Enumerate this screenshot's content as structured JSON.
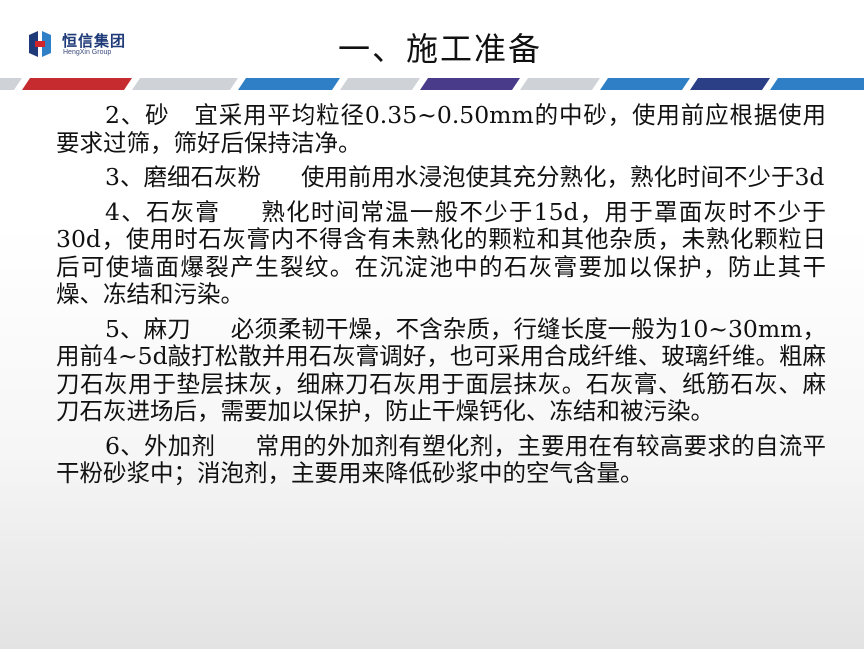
{
  "logo": {
    "name_cn": "恒信集团",
    "name_en": "HengXin Group",
    "icon": "hengxin-logo-icon"
  },
  "title": "一、施工准备",
  "paragraphs": [
    {
      "head": "2、砂",
      "body": "宜采用平均粒径0.35~0.50mm的中砂，使用前应根据使用要求过筛，筛好后保持洁净。"
    },
    {
      "head": "3、磨细石灰粉",
      "body": "使用前用水浸泡使其充分熟化，熟化时间不少于3d"
    },
    {
      "head": "4、石灰膏",
      "body": "熟化时间常温一般不少于15d，用于罩面灰时不少于30d，使用时石灰膏内不得含有未熟化的颗粒和其他杂质，未熟化颗粒日后可使墙面爆裂产生裂纹。在沉淀池中的石灰膏要加以保护，防止其干燥、冻结和污染。"
    },
    {
      "head": "5、麻刀",
      "body": "必须柔韧干燥，不含杂质，行缝长度一般为10~30mm，用前4~5d敲打松散并用石灰膏调好，也可采用合成纤维、玻璃纤维。粗麻刀石灰用于垫层抹灰，细麻刀石灰用于面层抹灰。石灰膏、纸筋石灰、麻刀石灰进场后，需要加以保护，防止干燥钙化、冻结和被污染。"
    },
    {
      "head": "6、外加剂",
      "body": "常用的外加剂有塑化剂，主要用在有较高要求的自流平干粉砂浆中；消泡剂，主要用来降低砂浆中的空气含量。"
    }
  ],
  "colors": {
    "band_red": "#c62b30",
    "band_blue": "#2f7fc6",
    "band_navy": "#2a3f86",
    "band_purple": "#4a3a8a",
    "band_gray": "#cfd3d8",
    "logo_blue": "#1f3a78",
    "logo_red": "#d2252b"
  }
}
